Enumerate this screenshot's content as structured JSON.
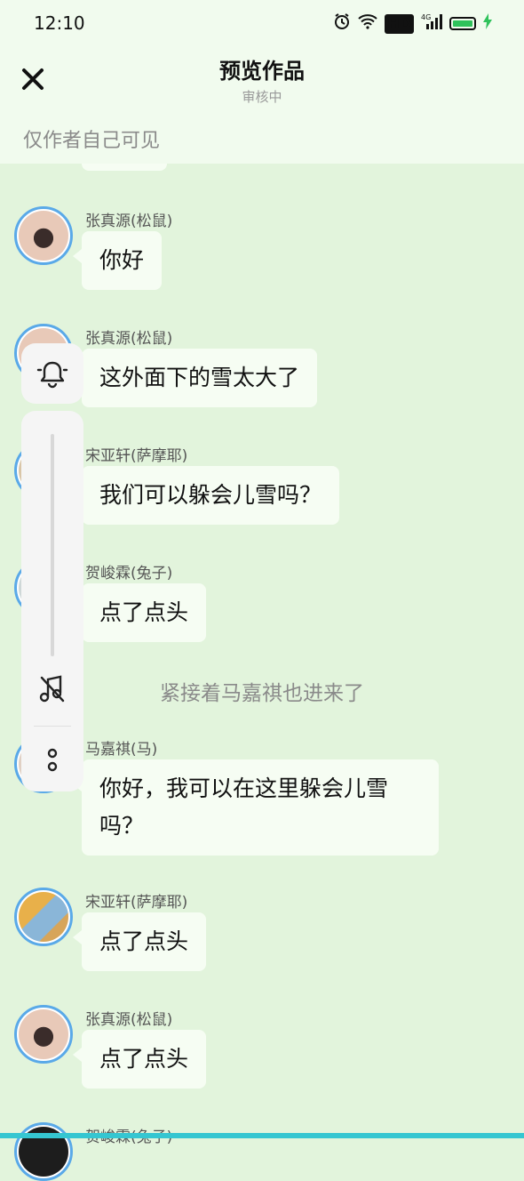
{
  "status_bar": {
    "time": "12:10",
    "icons": [
      "alarm-icon",
      "wifi-icon",
      "hd-icon",
      "signal-4g-icon",
      "battery-charging-icon"
    ],
    "hd_label": "HD",
    "network_label": "4G",
    "battery_color": "#2fc25b"
  },
  "header": {
    "title": "预览作品",
    "subtitle": "审核中",
    "visibility_note": "仅作者自己可见",
    "close_icon": "close-icon"
  },
  "messages": [
    {
      "sender": "张真源(松鼠)",
      "text": "你好"
    },
    {
      "sender": "张真源(松鼠)",
      "text": "这外面下的雪太大了"
    },
    {
      "sender": "宋亚轩(萨摩耶)",
      "text": "我们可以躲会儿雪吗？"
    },
    {
      "sender": "贺峻霖(兔子)",
      "text": "点了点头"
    },
    {
      "narration": "紧接着马嘉祺也进来了"
    },
    {
      "sender": "马嘉祺(马)",
      "text": "你好，我可以在这里躲会儿雪吗？"
    },
    {
      "sender": "宋亚轩(萨摩耶)",
      "text": "点了点头"
    },
    {
      "sender": "张真源(松鼠)",
      "text": "点了点头"
    },
    {
      "sender": "贺峻霖(兔子)",
      "text": ""
    }
  ],
  "floating_controls": {
    "icons": [
      "bell-icon",
      "music-off-icon",
      "more-icon"
    ]
  },
  "colors": {
    "background": "#e2f4dc",
    "header_background": "#f1fbee",
    "bubble": "#f6fdf3",
    "avatar_ring": "#5aa9e8",
    "accent_strip": "#35c6d1"
  }
}
